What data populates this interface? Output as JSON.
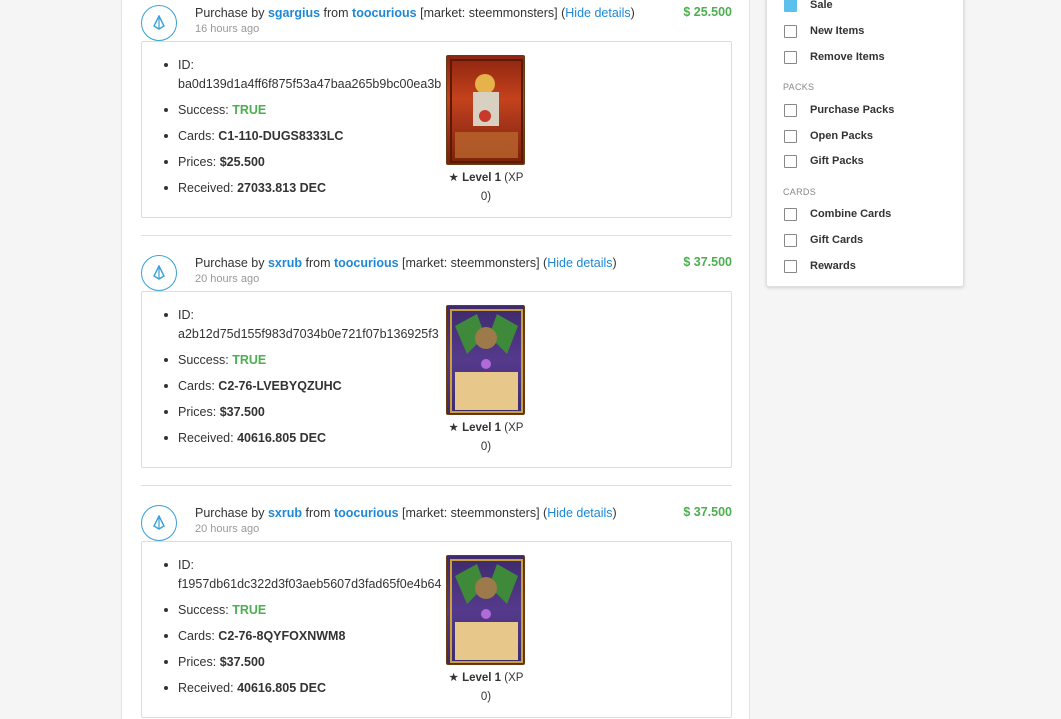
{
  "transactions": [
    {
      "prefix": "Purchase by ",
      "buyer": "sgargius",
      "from_word": " from ",
      "seller": "toocurious",
      "market": " [market: steemmonsters] (",
      "hide": "Hide details",
      "close": ")",
      "time": "16 hours ago",
      "amount": "$ 25.500",
      "id_label": "ID:",
      "id_value": "ba0d139d1a4ff6f875f53a47baa265b9bc00ea3b",
      "success_label": "Success: ",
      "success_value": "TRUE",
      "cards_label": "Cards: ",
      "cards_value": "C1-110-DUGS8333LC",
      "prices_label": "Prices: ",
      "prices_value": "$25.500",
      "received_label": "Received: ",
      "received_value": "27033.813 DEC",
      "card_style": "red",
      "level_label": "Level 1",
      "xp_text": " (XP 0)"
    },
    {
      "prefix": "Purchase by ",
      "buyer": "sxrub",
      "from_word": " from ",
      "seller": "toocurious",
      "market": " [market: steemmonsters] (",
      "hide": "Hide details",
      "close": ")",
      "time": "20 hours ago",
      "amount": "$ 37.500",
      "id_label": "ID:",
      "id_value": "a2b12d75d155f983d7034b0e721f07b136925f3",
      "success_label": "Success: ",
      "success_value": "TRUE",
      "cards_label": "Cards: ",
      "cards_value": "C2-76-LVEBYQZUHC",
      "prices_label": "Prices: ",
      "prices_value": "$37.500",
      "received_label": "Received: ",
      "received_value": "40616.805 DEC",
      "card_style": "purple",
      "level_label": "Level 1",
      "xp_text": " (XP 0)"
    },
    {
      "prefix": "Purchase by ",
      "buyer": "sxrub",
      "from_word": " from ",
      "seller": "toocurious",
      "market": " [market: steemmonsters] (",
      "hide": "Hide details",
      "close": ")",
      "time": "20 hours ago",
      "amount": "$ 37.500",
      "id_label": "ID:",
      "id_value": "f1957db61dc322d3f03aeb5607d3fad65f0e4b64",
      "success_label": "Success: ",
      "success_value": "TRUE",
      "cards_label": "Cards: ",
      "cards_value": "C2-76-8QYFOXNWM8",
      "prices_label": "Prices: ",
      "prices_value": "$37.500",
      "received_label": "Received: ",
      "received_value": "40616.805 DEC",
      "card_style": "purple",
      "level_label": "Level 1",
      "xp_text": " (XP 0)"
    }
  ],
  "filters": {
    "sale": "Sale",
    "new_items": "New Items",
    "remove_items": "Remove Items",
    "packs_heading": "PACKS",
    "purchase_packs": "Purchase Packs",
    "open_packs": "Open Packs",
    "gift_packs": "Gift Packs",
    "cards_heading": "CARDS",
    "combine_cards": "Combine Cards",
    "gift_cards": "Gift Cards",
    "rewards": "Rewards"
  },
  "colors": {
    "link": "#1e88d6",
    "success": "#4caf50",
    "checkbox_checked": "#5bc0eb"
  }
}
